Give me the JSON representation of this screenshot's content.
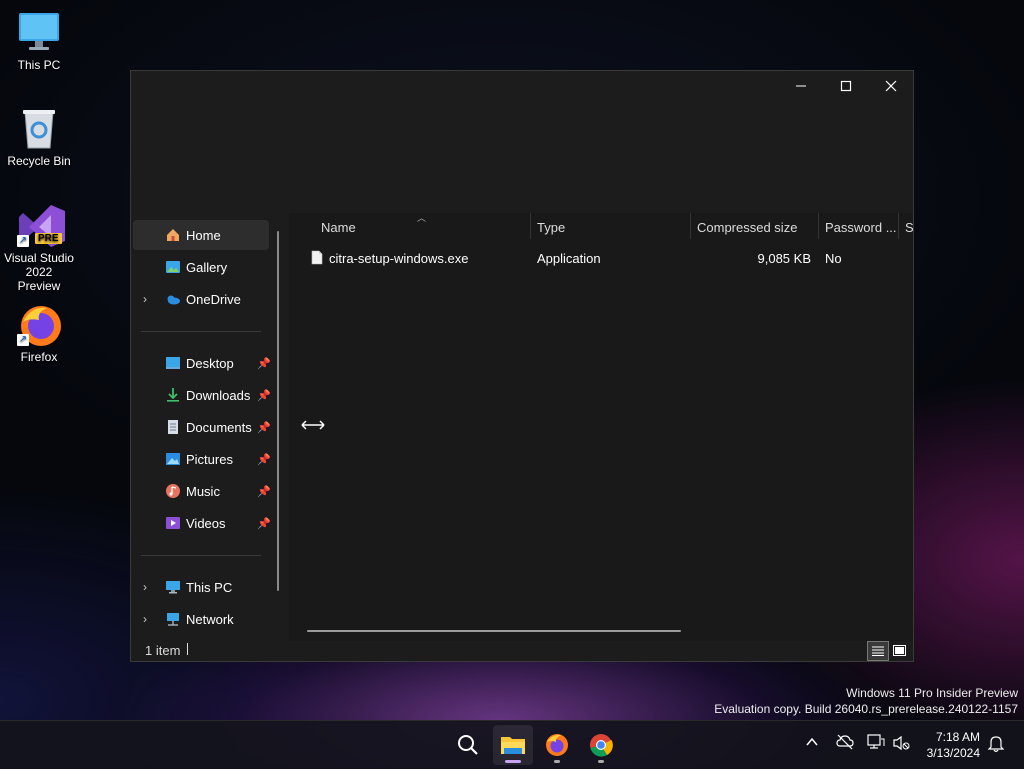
{
  "desktop": {
    "icons": [
      {
        "label": "This PC"
      },
      {
        "label": "Recycle Bin"
      },
      {
        "label": "Visual Studio 2022 Preview",
        "badge": "PRE"
      },
      {
        "label": "Firefox"
      }
    ]
  },
  "window": {
    "controls": {
      "minimize": "—",
      "maximize": "☐",
      "close": "✕"
    },
    "nav": {
      "home": "Home",
      "gallery": "Gallery",
      "onedrive": "OneDrive",
      "desktop": "Desktop",
      "downloads": "Downloads",
      "documents": "Documents",
      "pictures": "Pictures",
      "music": "Music",
      "videos": "Videos",
      "this_pc": "This PC",
      "network": "Network"
    },
    "columns": {
      "name": "Name",
      "type": "Type",
      "compressed_size": "Compressed size",
      "password": "Password ...",
      "size_partial": "Si"
    },
    "files": [
      {
        "name": "citra-setup-windows.exe",
        "type": "Application",
        "compressed_size": "9,085 KB",
        "password": "No"
      }
    ],
    "status": {
      "count": "1 item"
    }
  },
  "watermark": {
    "line1": "Windows 11 Pro Insider Preview",
    "line2": "Evaluation copy. Build 26040.rs_prerelease.240122-1157"
  },
  "taskbar": {
    "clock_time": "7:18 AM",
    "clock_date": "3/13/2024",
    "icons": [
      "search-icon",
      "file-explorer-icon",
      "firefox-icon",
      "chrome-icon"
    ]
  },
  "colors": {
    "accent_blue": "#4cc2ff",
    "folder_yellow": "#f8c639",
    "vs_purple": "#8c4fd6"
  }
}
